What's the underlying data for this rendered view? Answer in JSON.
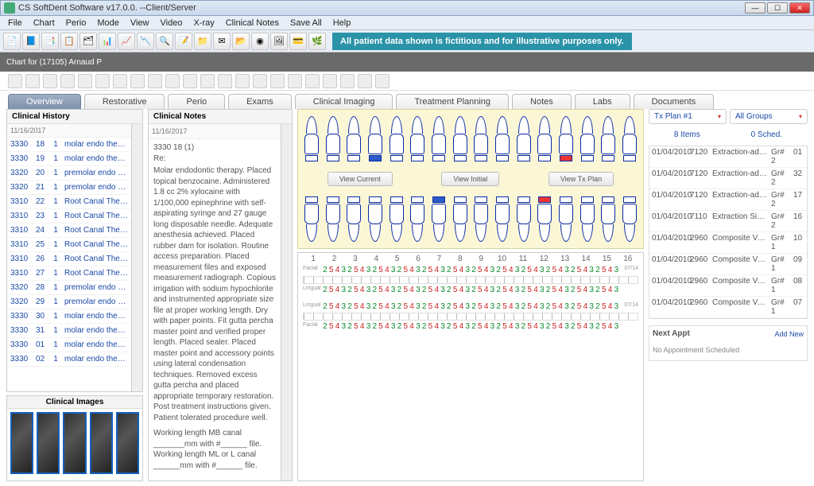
{
  "window": {
    "title": "CS SoftDent Software v17.0.0. --Client/Server"
  },
  "menu": [
    "File",
    "Chart",
    "Perio",
    "Mode",
    "View",
    "Video",
    "X-ray",
    "Clinical Notes",
    "Save All",
    "Help"
  ],
  "banner": "All patient data shown is fictitious and for illustrative purposes only.",
  "chart_header": "Chart for (17105) Arnaud P",
  "tabs": [
    "Overview",
    "Restorative",
    "Perio",
    "Exams",
    "Clinical Imaging",
    "Treatment Planning",
    "Notes",
    "Labs",
    "Documents"
  ],
  "clinical_history": {
    "title": "Clinical History",
    "date": "11/16/2017",
    "rows": [
      {
        "a": "3330",
        "b": "18",
        "c": "1",
        "d": "molar endo therapy"
      },
      {
        "a": "3330",
        "b": "19",
        "c": "1",
        "d": "molar endo therapy"
      },
      {
        "a": "3320",
        "b": "20",
        "c": "1",
        "d": "premolar endo therap"
      },
      {
        "a": "3320",
        "b": "21",
        "c": "1",
        "d": "premolar endo therap"
      },
      {
        "a": "3310",
        "b": "22",
        "c": "1",
        "d": "Root Canal Therapy -"
      },
      {
        "a": "3310",
        "b": "23",
        "c": "1",
        "d": "Root Canal Therapy -"
      },
      {
        "a": "3310",
        "b": "24",
        "c": "1",
        "d": "Root Canal Therapy -"
      },
      {
        "a": "3310",
        "b": "25",
        "c": "1",
        "d": "Root Canal Therapy -"
      },
      {
        "a": "3310",
        "b": "26",
        "c": "1",
        "d": "Root Canal Therapy -"
      },
      {
        "a": "3310",
        "b": "27",
        "c": "1",
        "d": "Root Canal Therapy -"
      },
      {
        "a": "3320",
        "b": "28",
        "c": "1",
        "d": "premolar endo therap"
      },
      {
        "a": "3320",
        "b": "29",
        "c": "1",
        "d": "premolar endo therap"
      },
      {
        "a": "3330",
        "b": "30",
        "c": "1",
        "d": "molar endo therapy"
      },
      {
        "a": "3330",
        "b": "31",
        "c": "1",
        "d": "molar endo therapy"
      },
      {
        "a": "3330",
        "b": "01",
        "c": "1",
        "d": "molar endo therapy"
      },
      {
        "a": "3330",
        "b": "02",
        "c": "1",
        "d": "molar endo therapy"
      }
    ]
  },
  "clinical_notes": {
    "title": "Clinical Notes",
    "date": "11/16/2017",
    "header": "3330   18     (1)",
    "re": "Re:",
    "body": "Molar endodontic therapy.  Placed topical benzocaine.  Administered 1.8 cc 2% xylocaine with 1/100,000 epinephrine with self-aspirating syringe and 27 gauge long disposable needle.  Adequate anesthesia achieved.  Placed rubber dam for isolation.  Routine access preparation.  Placed measurement files and exposed measurement radiograph.  Copious irrigation with sodium hypochlorite and instrumented appropriate size file at proper working length.  Dry with paper points.  Fit gutta percha master point and verified proper length.  Placed sealer.  Placed master point and accessory points using lateral condensation techniques.  Removed excess gutta percha and placed appropriate temporary restoration.  Post treatment instructions given.  Patient tolerated procedure well.",
    "wl1": "Working length MB canal _______mm with #______ file.",
    "wl2": "Working length ML or L canal ______mm with #______ file."
  },
  "clinical_images": {
    "title": "Clinical Images"
  },
  "view_buttons": {
    "current": "View  Current",
    "initial": "View  Initial",
    "txplan": "View  Tx Plan"
  },
  "perio": {
    "labels": [
      "Facial",
      "Lingual",
      "Lingual",
      "Facial"
    ],
    "top_nums": [
      "1",
      "2",
      "3",
      "4",
      "5",
      "6",
      "7",
      "8",
      "9",
      "10",
      "11",
      "12",
      "13",
      "14",
      "15",
      "16"
    ],
    "right_label": "07/14"
  },
  "right": {
    "txplan_label": "Tx Plan #1",
    "groups_label": "All Groups",
    "items_count": "8 Items",
    "sched_count": "0 Sched.",
    "rows": [
      {
        "d": "01/04/2010",
        "c": "7120",
        "t": "Extraction-additional",
        "g": "Gr# 2",
        "n": "01"
      },
      {
        "d": "01/04/2010",
        "c": "7120",
        "t": "Extraction-additional",
        "g": "Gr# 2",
        "n": "32"
      },
      {
        "d": "01/04/2010",
        "c": "7120",
        "t": "Extraction-additional",
        "g": "Gr# 2",
        "n": "17"
      },
      {
        "d": "01/04/2010",
        "c": "7110",
        "t": "Extraction Single Tooth",
        "g": "Gr# 2",
        "n": "16"
      },
      {
        "d": "01/04/2010",
        "c": "2960",
        "t": "Composite Veneer",
        "g": "Gr# 1",
        "n": "10"
      },
      {
        "d": "01/04/2010",
        "c": "2960",
        "t": "Composite Veneer",
        "g": "Gr# 1",
        "n": "09"
      },
      {
        "d": "01/04/2010",
        "c": "2960",
        "t": "Composite Veneer",
        "g": "Gr# 1",
        "n": "08"
      },
      {
        "d": "01/04/2010",
        "c": "2960",
        "t": "Composite Veneer",
        "g": "Gr# 1",
        "n": "07"
      }
    ],
    "next_appt": "Next Appt",
    "add_new": "Add  New",
    "no_appt": "No Appointment Scheduled"
  }
}
